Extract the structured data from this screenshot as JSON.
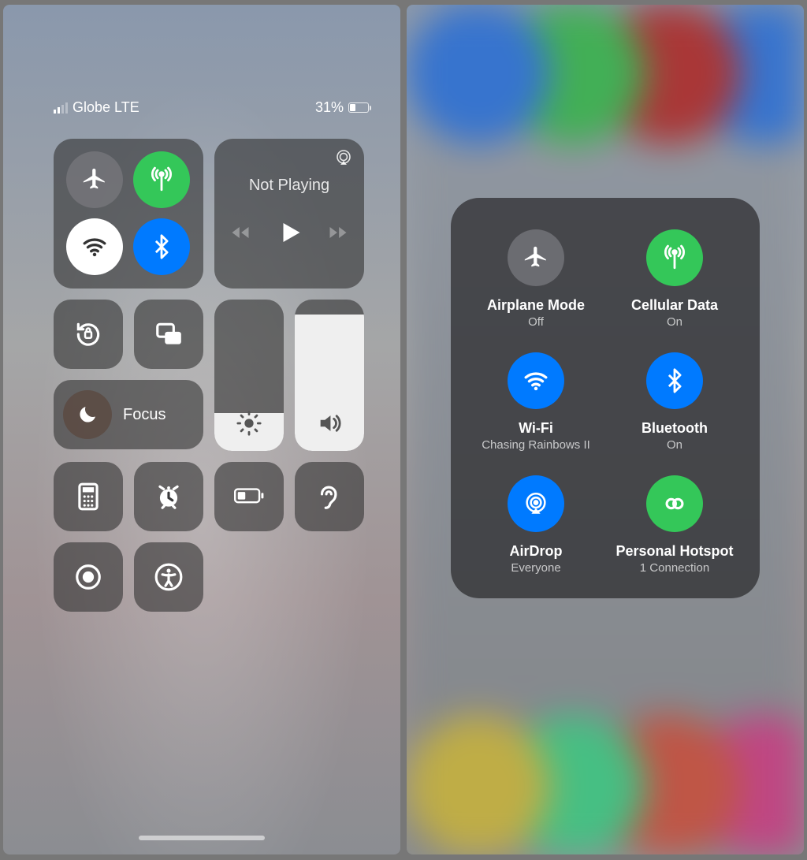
{
  "status": {
    "carrier": "Globe LTE",
    "battery_pct": "31%"
  },
  "media": {
    "now_playing": "Not Playing"
  },
  "focus": {
    "label": "Focus"
  },
  "sliders": {
    "brightness_pct": 25,
    "volume_pct": 90
  },
  "expanded": {
    "airplane": {
      "title": "Airplane Mode",
      "sub": "Off"
    },
    "cellular": {
      "title": "Cellular Data",
      "sub": "On"
    },
    "wifi": {
      "title": "Wi-Fi",
      "sub": "Chasing Rainbows II"
    },
    "bluetooth": {
      "title": "Bluetooth",
      "sub": "On"
    },
    "airdrop": {
      "title": "AirDrop",
      "sub": "Everyone"
    },
    "hotspot": {
      "title": "Personal Hotspot",
      "sub": "1 Connection"
    }
  },
  "colors": {
    "blue": "#007aff",
    "green": "#34c759"
  }
}
